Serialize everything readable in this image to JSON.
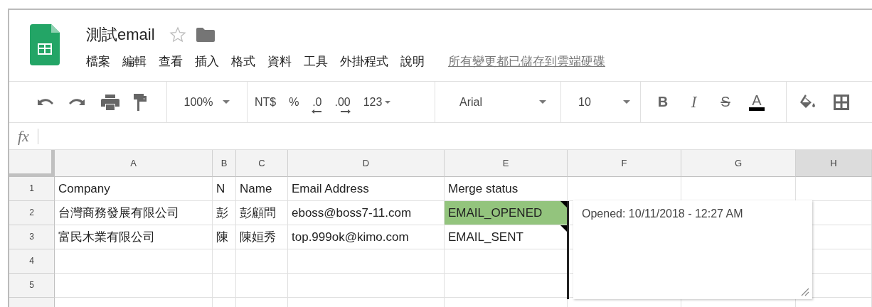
{
  "document": {
    "title": "測試email",
    "starred": false,
    "save_status": "所有變更都已儲存到雲端硬碟"
  },
  "menu": [
    "檔案",
    "編輯",
    "查看",
    "插入",
    "格式",
    "資料",
    "工具",
    "外掛程式",
    "說明"
  ],
  "toolbar": {
    "zoom": "100%",
    "number_formats": [
      {
        "label": "NT$",
        "kind": "plain"
      },
      {
        "label": "%",
        "kind": "plain"
      },
      {
        "label": ".0",
        "kind": "left-arrow"
      },
      {
        "label": ".00",
        "kind": "right-arrow"
      },
      {
        "label": "123",
        "kind": "menu"
      }
    ],
    "font": "Arial",
    "font_size": "10",
    "text_styles": [
      {
        "label": "B",
        "kind": "bold"
      },
      {
        "label": "I",
        "kind": "italic"
      },
      {
        "label": "S",
        "kind": "strike"
      },
      {
        "label": "A",
        "kind": "color"
      }
    ]
  },
  "formula_bar": {
    "label": "fx"
  },
  "columns": [
    {
      "label": "A",
      "selected": false
    },
    {
      "label": "B",
      "selected": false
    },
    {
      "label": "C",
      "selected": false
    },
    {
      "label": "D",
      "selected": false
    },
    {
      "label": "E",
      "selected": false
    },
    {
      "label": "F",
      "selected": false
    },
    {
      "label": "G",
      "selected": false
    },
    {
      "label": "H",
      "selected": true
    }
  ],
  "rows": [
    {
      "number": "1",
      "cells": [
        {
          "text": "Company"
        },
        {
          "text": "N"
        },
        {
          "text": "Name"
        },
        {
          "text": "Email Address"
        },
        {
          "text": "Merge status"
        }
      ]
    },
    {
      "number": "2",
      "cells": [
        {
          "text": "台灣商務發展有限公司"
        },
        {
          "text": "彭"
        },
        {
          "text": "彭顧問"
        },
        {
          "text": "eboss@boss7-11.com"
        },
        {
          "text": "EMAIL_OPENED",
          "highlight": true,
          "note": true
        }
      ]
    },
    {
      "number": "3",
      "cells": [
        {
          "text": "富民木業有限公司"
        },
        {
          "text": "陳"
        },
        {
          "text": "陳姮秀"
        },
        {
          "text": "top.999ok@kimo.com"
        },
        {
          "text": "EMAIL_SENT",
          "note": true
        }
      ]
    },
    {
      "number": "4",
      "cells": []
    },
    {
      "number": "5",
      "cells": []
    },
    {
      "cells": []
    }
  ],
  "note": {
    "text": "Opened: 10/11/2018 - 12:27 AM"
  }
}
